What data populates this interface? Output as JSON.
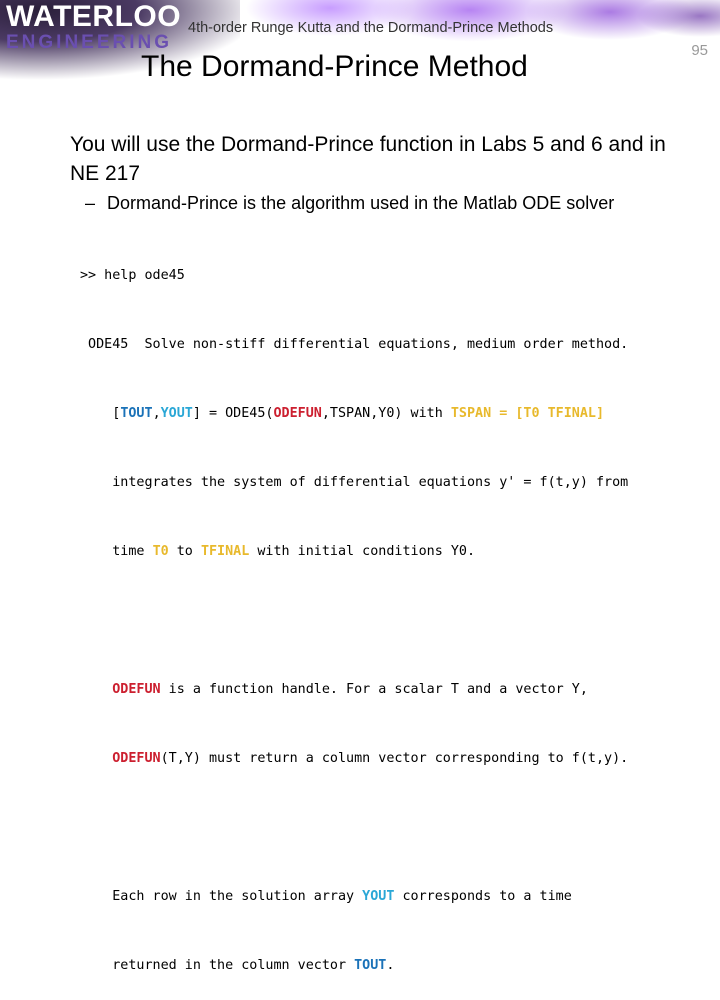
{
  "header": {
    "logo_top": "WATERLOO",
    "logo_bottom": "ENGINEERING",
    "subtitle": "4th-order Runge Kutta and the Dormand-Prince Methods",
    "page_number": "95"
  },
  "slide": {
    "title": "The Dormand-Prince Method",
    "bullet_1": "You will use the Dormand-Prince function in Labs 5 and 6 and in NE 217",
    "bullet_2_dash": "–",
    "bullet_2": "Dormand-Prince is the algorithm used in the Matlab ODE solver"
  },
  "colors": {
    "tout": "#1a72b8",
    "yout": "#2aa7d6",
    "odefun": "#cc1f2f",
    "tspan": "#e8b92c"
  },
  "code": {
    "l1": ">> help ode45",
    "l2": " ODE45  Solve non-stiff differential equations, medium order method.",
    "l3": {
      "a": "    [",
      "tout": "TOUT",
      "b": ",",
      "yout": "YOUT",
      "c": "] = ODE45(",
      "odefun": "ODEFUN",
      "d": ",TSPAN,Y0) with ",
      "tspan": "TSPAN = [T0 TFINAL]"
    },
    "l4": "    integrates the system of differential equations y' = f(t,y) from",
    "l5": {
      "a": "    time ",
      "t0": "T0",
      "b": " to ",
      "tfinal": "TFINAL",
      "c": " with initial conditions Y0."
    },
    "l6": {
      "odefun": "ODEFUN",
      "a": " is a function handle. For a scalar T and a vector Y,"
    },
    "l7": {
      "odefun": "ODEFUN",
      "a": "(T,Y) must return a column vector corresponding to f(t,y)."
    },
    "l8": {
      "a": "    Each row in the solution array ",
      "yout": "YOUT",
      "b": " corresponds to a time"
    },
    "l9": {
      "a": "    returned in the column vector ",
      "tout": "TOUT",
      "b": "."
    }
  }
}
